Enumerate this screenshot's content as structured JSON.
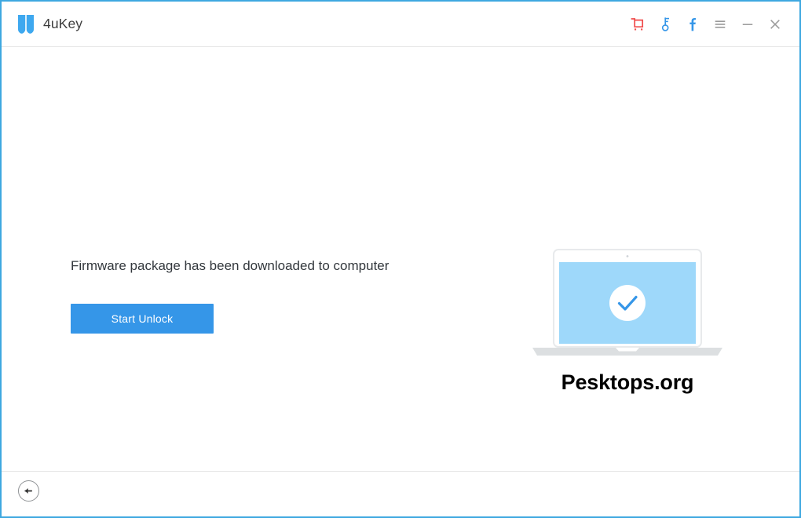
{
  "window": {
    "border_color": "#3ea8e0"
  },
  "titlebar": {
    "logo_icon": "shield-logo-icon",
    "app_title": "4uKey",
    "actions": [
      {
        "name": "cart-icon",
        "label": "Buy",
        "color": "#f04b4b"
      },
      {
        "name": "key-icon",
        "label": "Register",
        "color": "#3596e8"
      },
      {
        "name": "facebook-icon",
        "label": "Facebook",
        "color": "#3596e8"
      },
      {
        "name": "menu-icon",
        "label": "Menu",
        "color": "#9a9a9a"
      },
      {
        "name": "minimize-icon",
        "label": "Minimize",
        "color": "#9a9a9a"
      },
      {
        "name": "close-icon",
        "label": "Close",
        "color": "#9a9a9a"
      }
    ]
  },
  "main": {
    "status_text": "Firmware package has been downloaded to computer",
    "start_unlock_label": "Start Unlock",
    "button_color": "#3596e8",
    "illustration": {
      "name": "laptop-success-illustration",
      "screen_color": "#9ed8fa",
      "check_color": "#3596e8",
      "frame_color": "#e8eaec",
      "base_color": "#dcdfe1"
    },
    "watermark": "Pesktops.org"
  },
  "footer": {
    "back_label": "Back"
  }
}
